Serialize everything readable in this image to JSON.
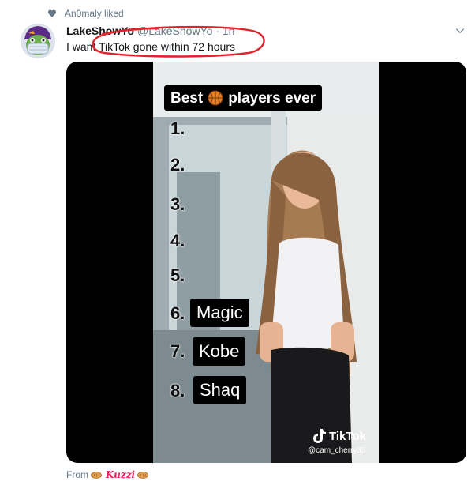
{
  "social_context": {
    "text": "An0maly liked"
  },
  "tweet": {
    "display_name": "LakeShowYo",
    "handle": "@LakeShowYo",
    "separator": "·",
    "time": "1h",
    "text": "I want TikTok gone within 72 hours"
  },
  "video": {
    "title_before": "Best",
    "title_after": "players ever",
    "numbers": [
      "1.",
      "2.",
      "3.",
      "4.",
      "5.",
      "6.",
      "7.",
      "8."
    ],
    "names": {
      "six": "Magic",
      "seven": "Kobe",
      "eight": "Shaq"
    },
    "watermark_brand": "TikTok",
    "watermark_user": "@cam_cherry35"
  },
  "source": {
    "from_label": "From",
    "from_name": "Kuzzi"
  },
  "icons": {
    "heart": "heart-icon",
    "chevron": "chevron-down-icon",
    "ball": "basketball-icon",
    "tiktok": "tiktok-note-icon",
    "bread": "bread-icon"
  },
  "colors": {
    "secondary_text": "#657786",
    "annotation": "#e0242b",
    "link": "#1da1f2"
  }
}
